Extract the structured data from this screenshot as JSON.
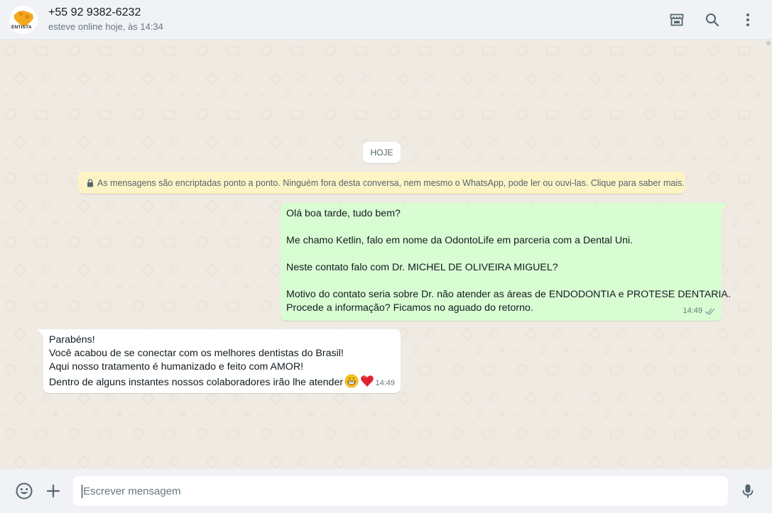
{
  "header": {
    "contact_name": "+55 92 9382-6232",
    "contact_status": "esteve online hoje, às 14:34",
    "avatar_text": "ENTISTA",
    "actions": [
      "store-icon",
      "search-icon",
      "menu-icon"
    ]
  },
  "chat": {
    "date_chip": "HOJE",
    "encryption_notice": "As mensagens são encriptadas ponto a ponto. Ninguém fora desta conversa, nem mesmo o WhatsApp, pode ler ou ouvi-las. Clique para saber mais.",
    "messages": [
      {
        "direction": "out",
        "lines": [
          "Olá boa tarde, tudo bem?",
          "",
          "Me chamo Ketlin, falo em nome da OdontoLife em parceria com a Dental Uni.",
          "",
          "Neste contato falo com Dr. MICHEL DE OLIVEIRA MIGUEL?",
          "",
          "Motivo do contato seria sobre Dr. não atender as áreas de ENDODONTIA e PROTESE DENTARIA.",
          "Procede a informação? Ficamos no aguado do retorno."
        ],
        "time": "14:49",
        "status": "delivered"
      },
      {
        "direction": "in",
        "lines": [
          "Parabéns!",
          "Você acabou de se conectar com os melhores dentistas do Brasil!",
          "Aqui nosso tratamento é humanizado e feito com AMOR!",
          "Dentro de alguns instantes nossos colaboradores irão lhe atender"
        ],
        "emojis": [
          "grinning-face-emoji",
          "red-heart-emoji"
        ],
        "time": "14:49"
      }
    ]
  },
  "footer": {
    "input_placeholder": "Escrever mensagem",
    "input_value": ""
  },
  "colors": {
    "outgoing_bubble": "#d9fdd3",
    "incoming_bubble": "#ffffff",
    "chat_background": "#efeae2",
    "bar_background": "#f0f2f5",
    "encryption_notice_bg": "#fdf4c5",
    "icon_gray": "#54656f"
  }
}
